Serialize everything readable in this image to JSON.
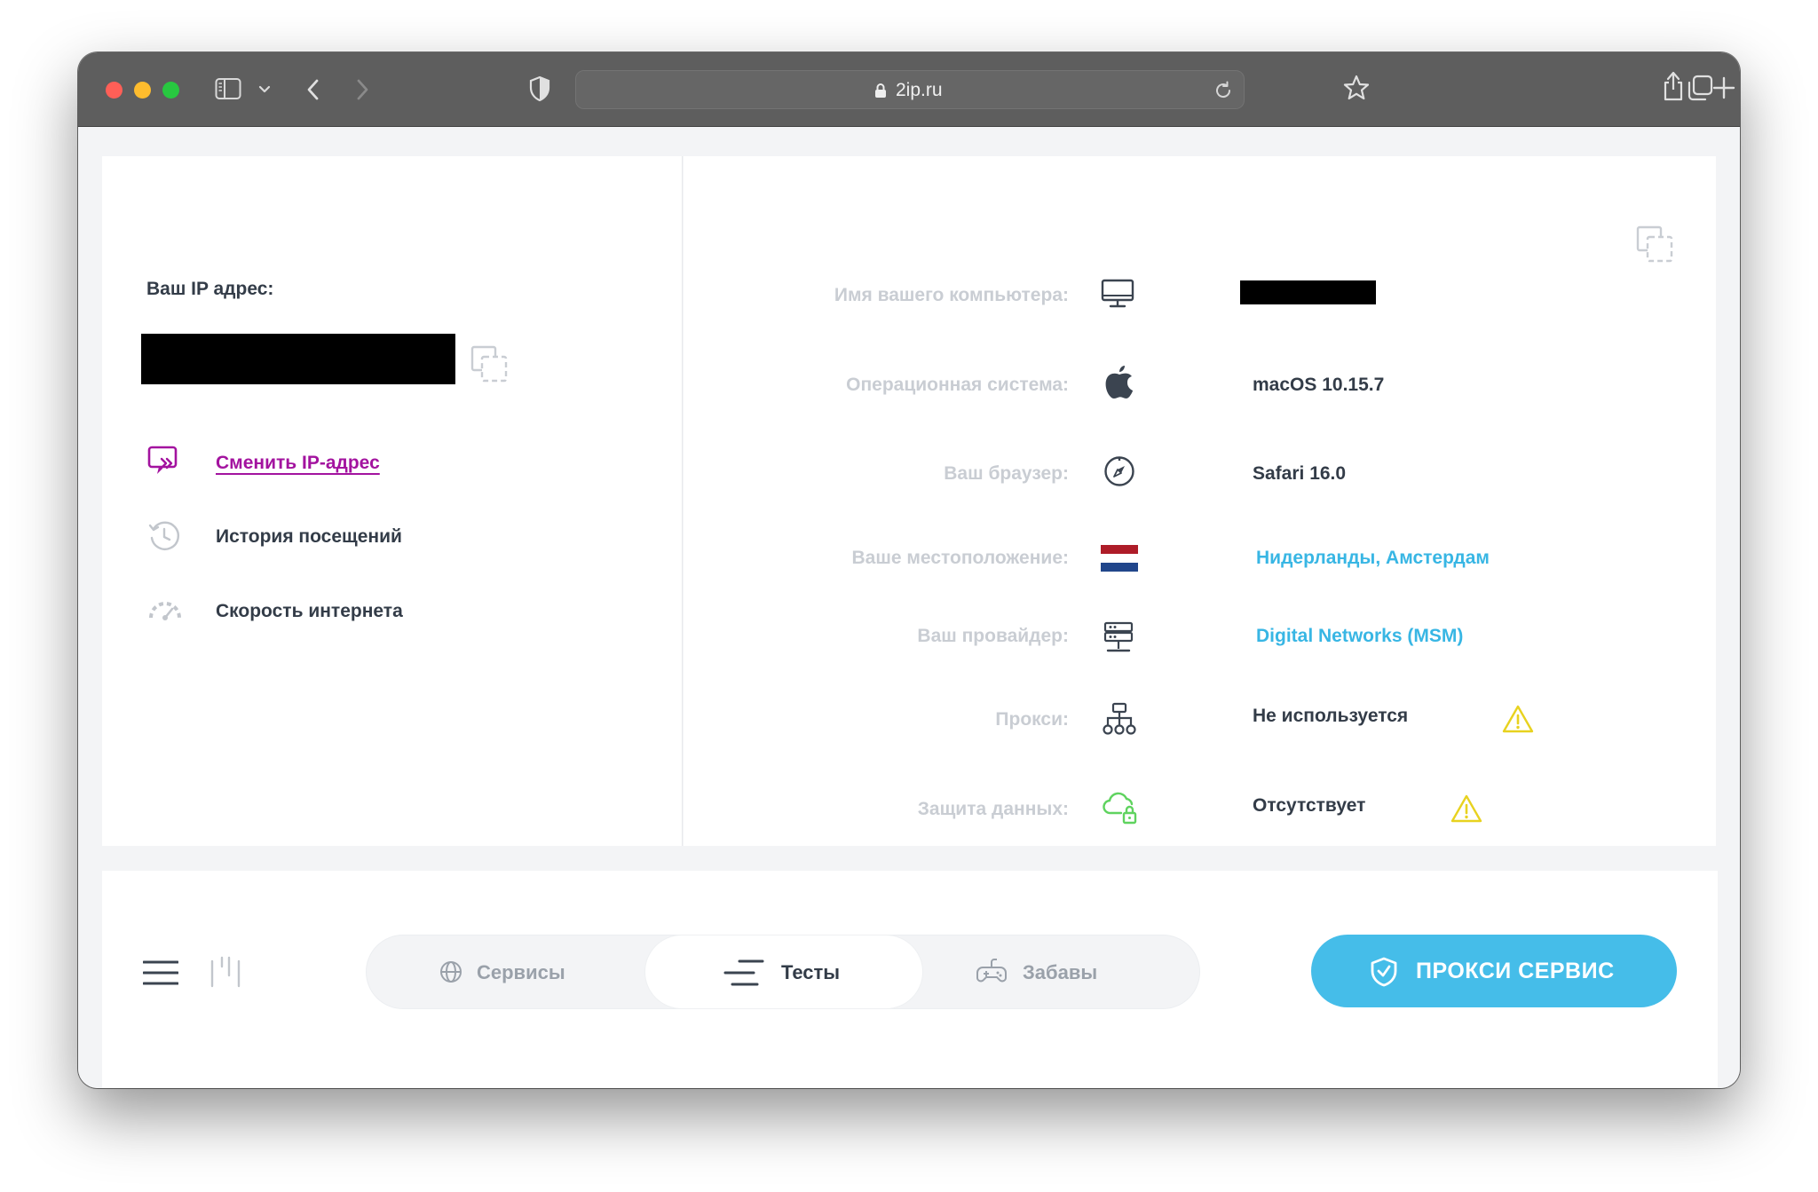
{
  "browser": {
    "url": "2ip.ru"
  },
  "ip_panel": {
    "label": "Ваш IP адрес:",
    "menu": [
      {
        "label": "Сменить IP-адрес",
        "icon": "change-ip-icon"
      },
      {
        "label": "История посещений",
        "icon": "history-icon"
      },
      {
        "label": "Скорость интернета",
        "icon": "speedometer-icon"
      }
    ]
  },
  "info": {
    "rows": [
      {
        "label": "Имя вашего компьютера:",
        "icon": "monitor-icon",
        "value": ""
      },
      {
        "label": "Операционная система:",
        "icon": "apple-icon",
        "value": "macOS 10.15.7"
      },
      {
        "label": "Ваш браузер:",
        "icon": "compass-icon",
        "value": "Safari 16.0"
      },
      {
        "label": "Ваше местоположение:",
        "icon": "netherlands-flag-icon",
        "value": "Нидерланды, Амстердам"
      },
      {
        "label": "Ваш провайдер:",
        "icon": "server-icon",
        "value": "Digital Networks (MSM)"
      },
      {
        "label": "Прокси:",
        "icon": "network-tree-icon",
        "value": "Не используется"
      },
      {
        "label": "Защита данных:",
        "icon": "cloud-lock-icon",
        "value": "Отсутствует"
      }
    ]
  },
  "nav": {
    "tabs": [
      {
        "label": "Сервисы",
        "icon": "globe-icon",
        "active": false
      },
      {
        "label": "Тесты",
        "icon": "lines-icon",
        "active": true
      },
      {
        "label": "Забавы",
        "icon": "gamepad-icon",
        "active": false
      }
    ],
    "proxy_button": "ПРОКСИ СЕРВИС"
  },
  "colors": {
    "link_purple": "#a3139f",
    "link_blue": "#38b6e4",
    "button_blue": "#45bde9",
    "warning_yellow": "#e8d21f",
    "cloud_green": "#5fd35f",
    "toolbar": "#5e5e5e"
  }
}
